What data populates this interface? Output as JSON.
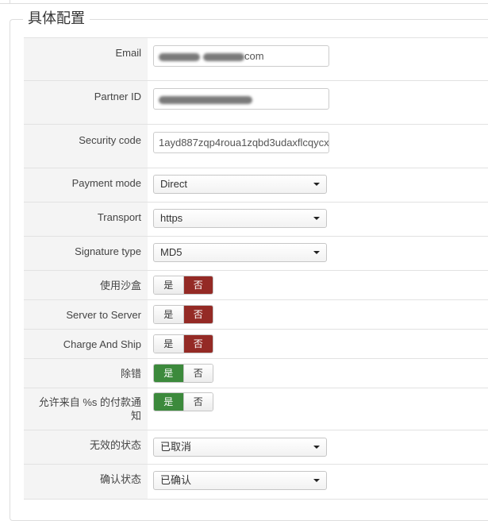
{
  "section": {
    "legend": "具体配置"
  },
  "fields": {
    "email": {
      "label": "Email",
      "value_suffix": "com"
    },
    "partner_id": {
      "label": "Partner ID"
    },
    "security_code": {
      "label": "Security code",
      "value": "1ayd887zqp4roua1zqbd3udaxflcqycx"
    },
    "payment_mode": {
      "label": "Payment mode",
      "selected": "Direct"
    },
    "transport": {
      "label": "Transport",
      "selected": "https"
    },
    "signature_type": {
      "label": "Signature type",
      "selected": "MD5"
    },
    "sandbox": {
      "label": "使用沙盒",
      "yes": "是",
      "no": "否",
      "value": "no"
    },
    "server_to_server": {
      "label": "Server to Server",
      "yes": "是",
      "no": "否",
      "value": "no"
    },
    "charge_and_ship": {
      "label": "Charge And Ship",
      "yes": "是",
      "no": "否",
      "value": "no"
    },
    "debug": {
      "label": "除错",
      "yes": "是",
      "no": "否",
      "value": "yes"
    },
    "allow_payment_notice": {
      "label_line1": "允许来自 %s 的付款通",
      "label_line2": "知",
      "yes": "是",
      "no": "否",
      "value": "yes"
    },
    "invalid_status": {
      "label": "无效的状态",
      "selected": "已取消"
    },
    "confirmed_status": {
      "label": "确认状态",
      "selected": "已确认"
    }
  },
  "colors": {
    "no_active": "#942a25",
    "yes_active": "#3c8a3c",
    "label_column_bg": "#f4f4f4"
  }
}
